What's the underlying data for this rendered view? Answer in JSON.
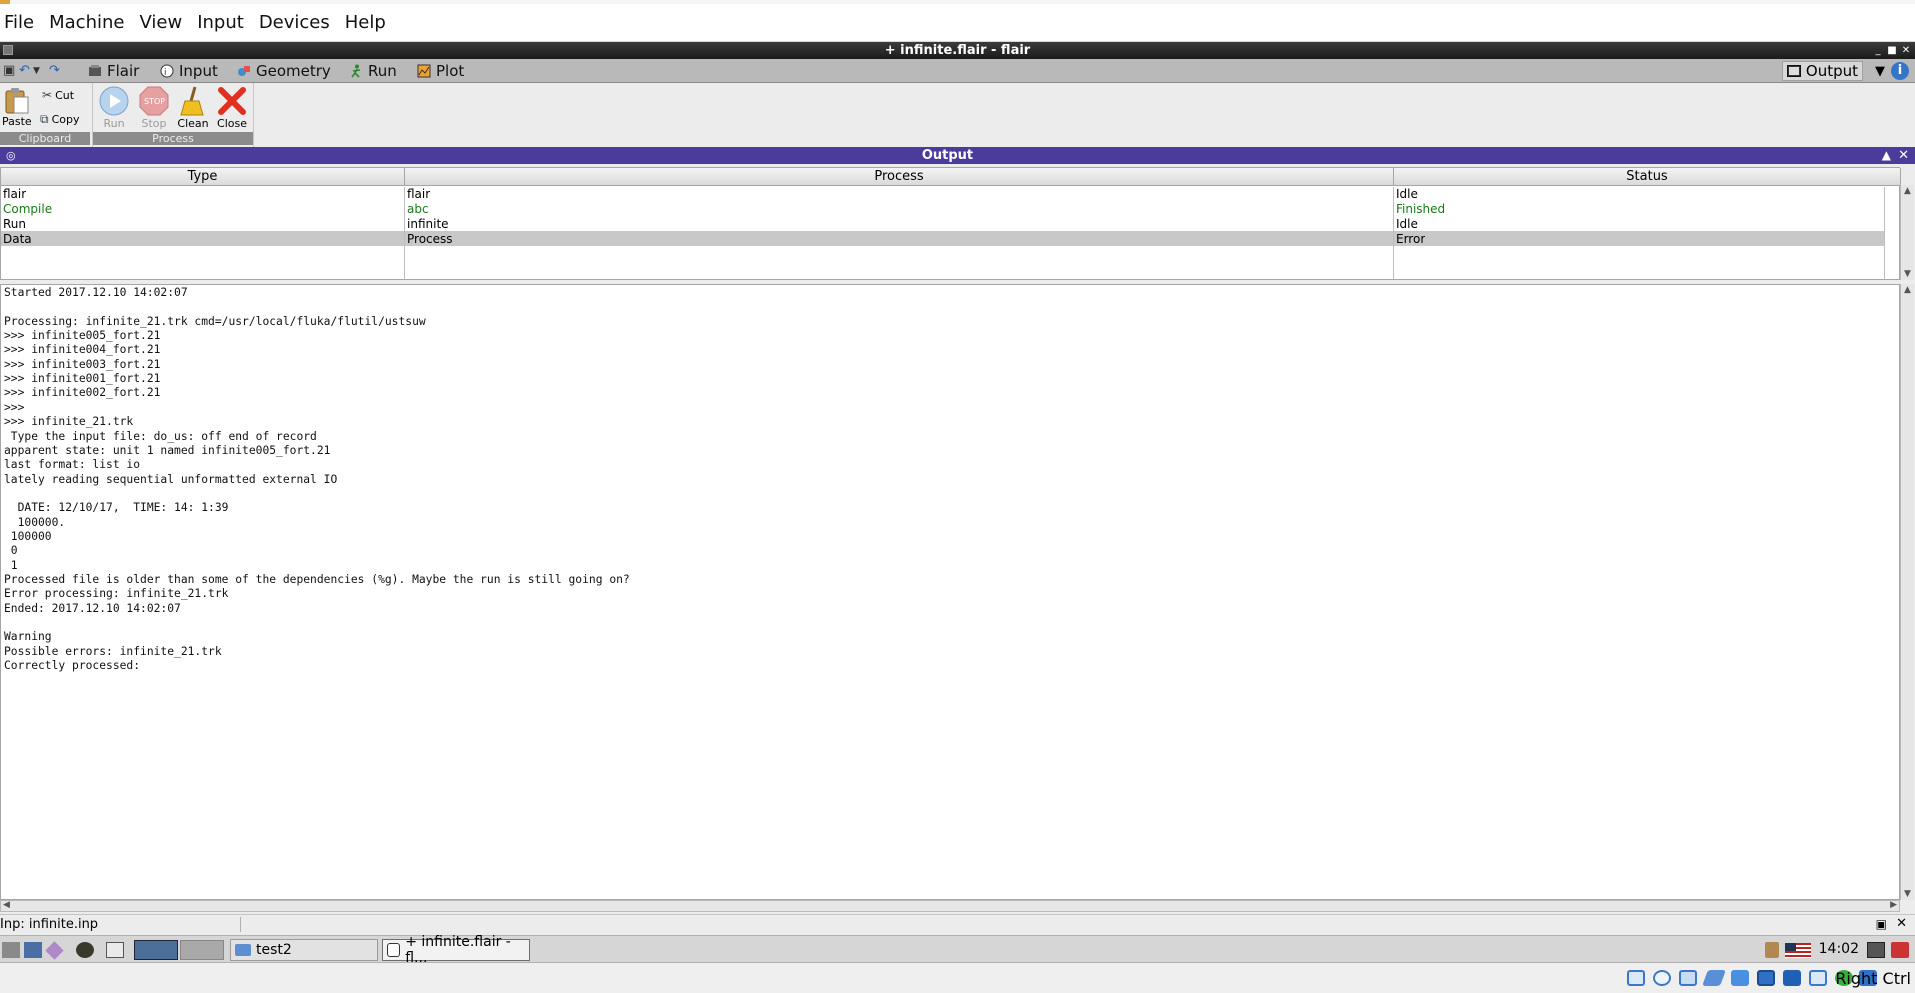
{
  "host_menu": [
    "File",
    "Machine",
    "View",
    "Input",
    "Devices",
    "Help"
  ],
  "window": {
    "title": "+ infinite.flair - flair"
  },
  "ribbon_tabs": [
    {
      "label": "Flair",
      "icon": "flair-icon"
    },
    {
      "label": "Input",
      "icon": "input-icon"
    },
    {
      "label": "Geometry",
      "icon": "geometry-icon"
    },
    {
      "label": "Run",
      "icon": "run-icon"
    },
    {
      "label": "Plot",
      "icon": "plot-icon"
    }
  ],
  "output_selector": "Output",
  "ribbon": {
    "clipboard": {
      "label": "Clipboard",
      "paste": "Paste",
      "cut": "Cut",
      "copy": "Copy"
    },
    "process": {
      "label": "Process",
      "run": "Run",
      "stop": "Stop",
      "clean": "Clean",
      "close": "Close"
    }
  },
  "output_panel": {
    "title": "Output"
  },
  "table": {
    "headers": [
      "Type",
      "Process",
      "Status"
    ],
    "rows": [
      {
        "type": "flair",
        "process": "flair",
        "status": "Idle",
        "color": "#000000",
        "selected": false
      },
      {
        "type": "Compile",
        "process": "abc",
        "status": "Finished",
        "color": "#1a7a1a",
        "selected": false
      },
      {
        "type": "Run",
        "process": "infinite",
        "status": "Idle",
        "color": "#000000",
        "selected": false
      },
      {
        "type": "Data",
        "process": "Process",
        "status": "Error",
        "color": "#000000",
        "selected": true
      }
    ]
  },
  "log_lines": [
    "Started 2017.12.10 14:02:07",
    "",
    "Processing: infinite_21.trk cmd=/usr/local/fluka/flutil/ustsuw",
    ">>> infinite005_fort.21",
    ">>> infinite004_fort.21",
    ">>> infinite003_fort.21",
    ">>> infinite001_fort.21",
    ">>> infinite002_fort.21",
    ">>>",
    ">>> infinite_21.trk",
    " Type the input file: do_us: off end of record",
    "apparent state: unit 1 named infinite005_fort.21",
    "last format: list io",
    "lately reading sequential unformatted external IO",
    "",
    "  DATE: 12/10/17,  TIME: 14: 1:39",
    "  100000.",
    " 100000",
    " 0",
    " 1",
    "Processed file is older than some of the dependencies (%g). Maybe the run is still going on?",
    "Error processing: infinite_21.trk",
    "Ended: 2017.12.10 14:02:07",
    "",
    "Warning",
    "Possible errors: infinite_21.trk",
    "Correctly processed:"
  ],
  "statusbar": {
    "text": "Inp: infinite.inp"
  },
  "taskbar": {
    "tasks": [
      "test2",
      "+ infinite.flair - fl..."
    ],
    "clock": "14:02"
  },
  "vbox": {
    "host_key": "Right Ctrl"
  },
  "colors": {
    "output_header": "#4b3b9a",
    "finished_green": "#1a7a1a",
    "ribbon_group": "#8b8b8b"
  }
}
